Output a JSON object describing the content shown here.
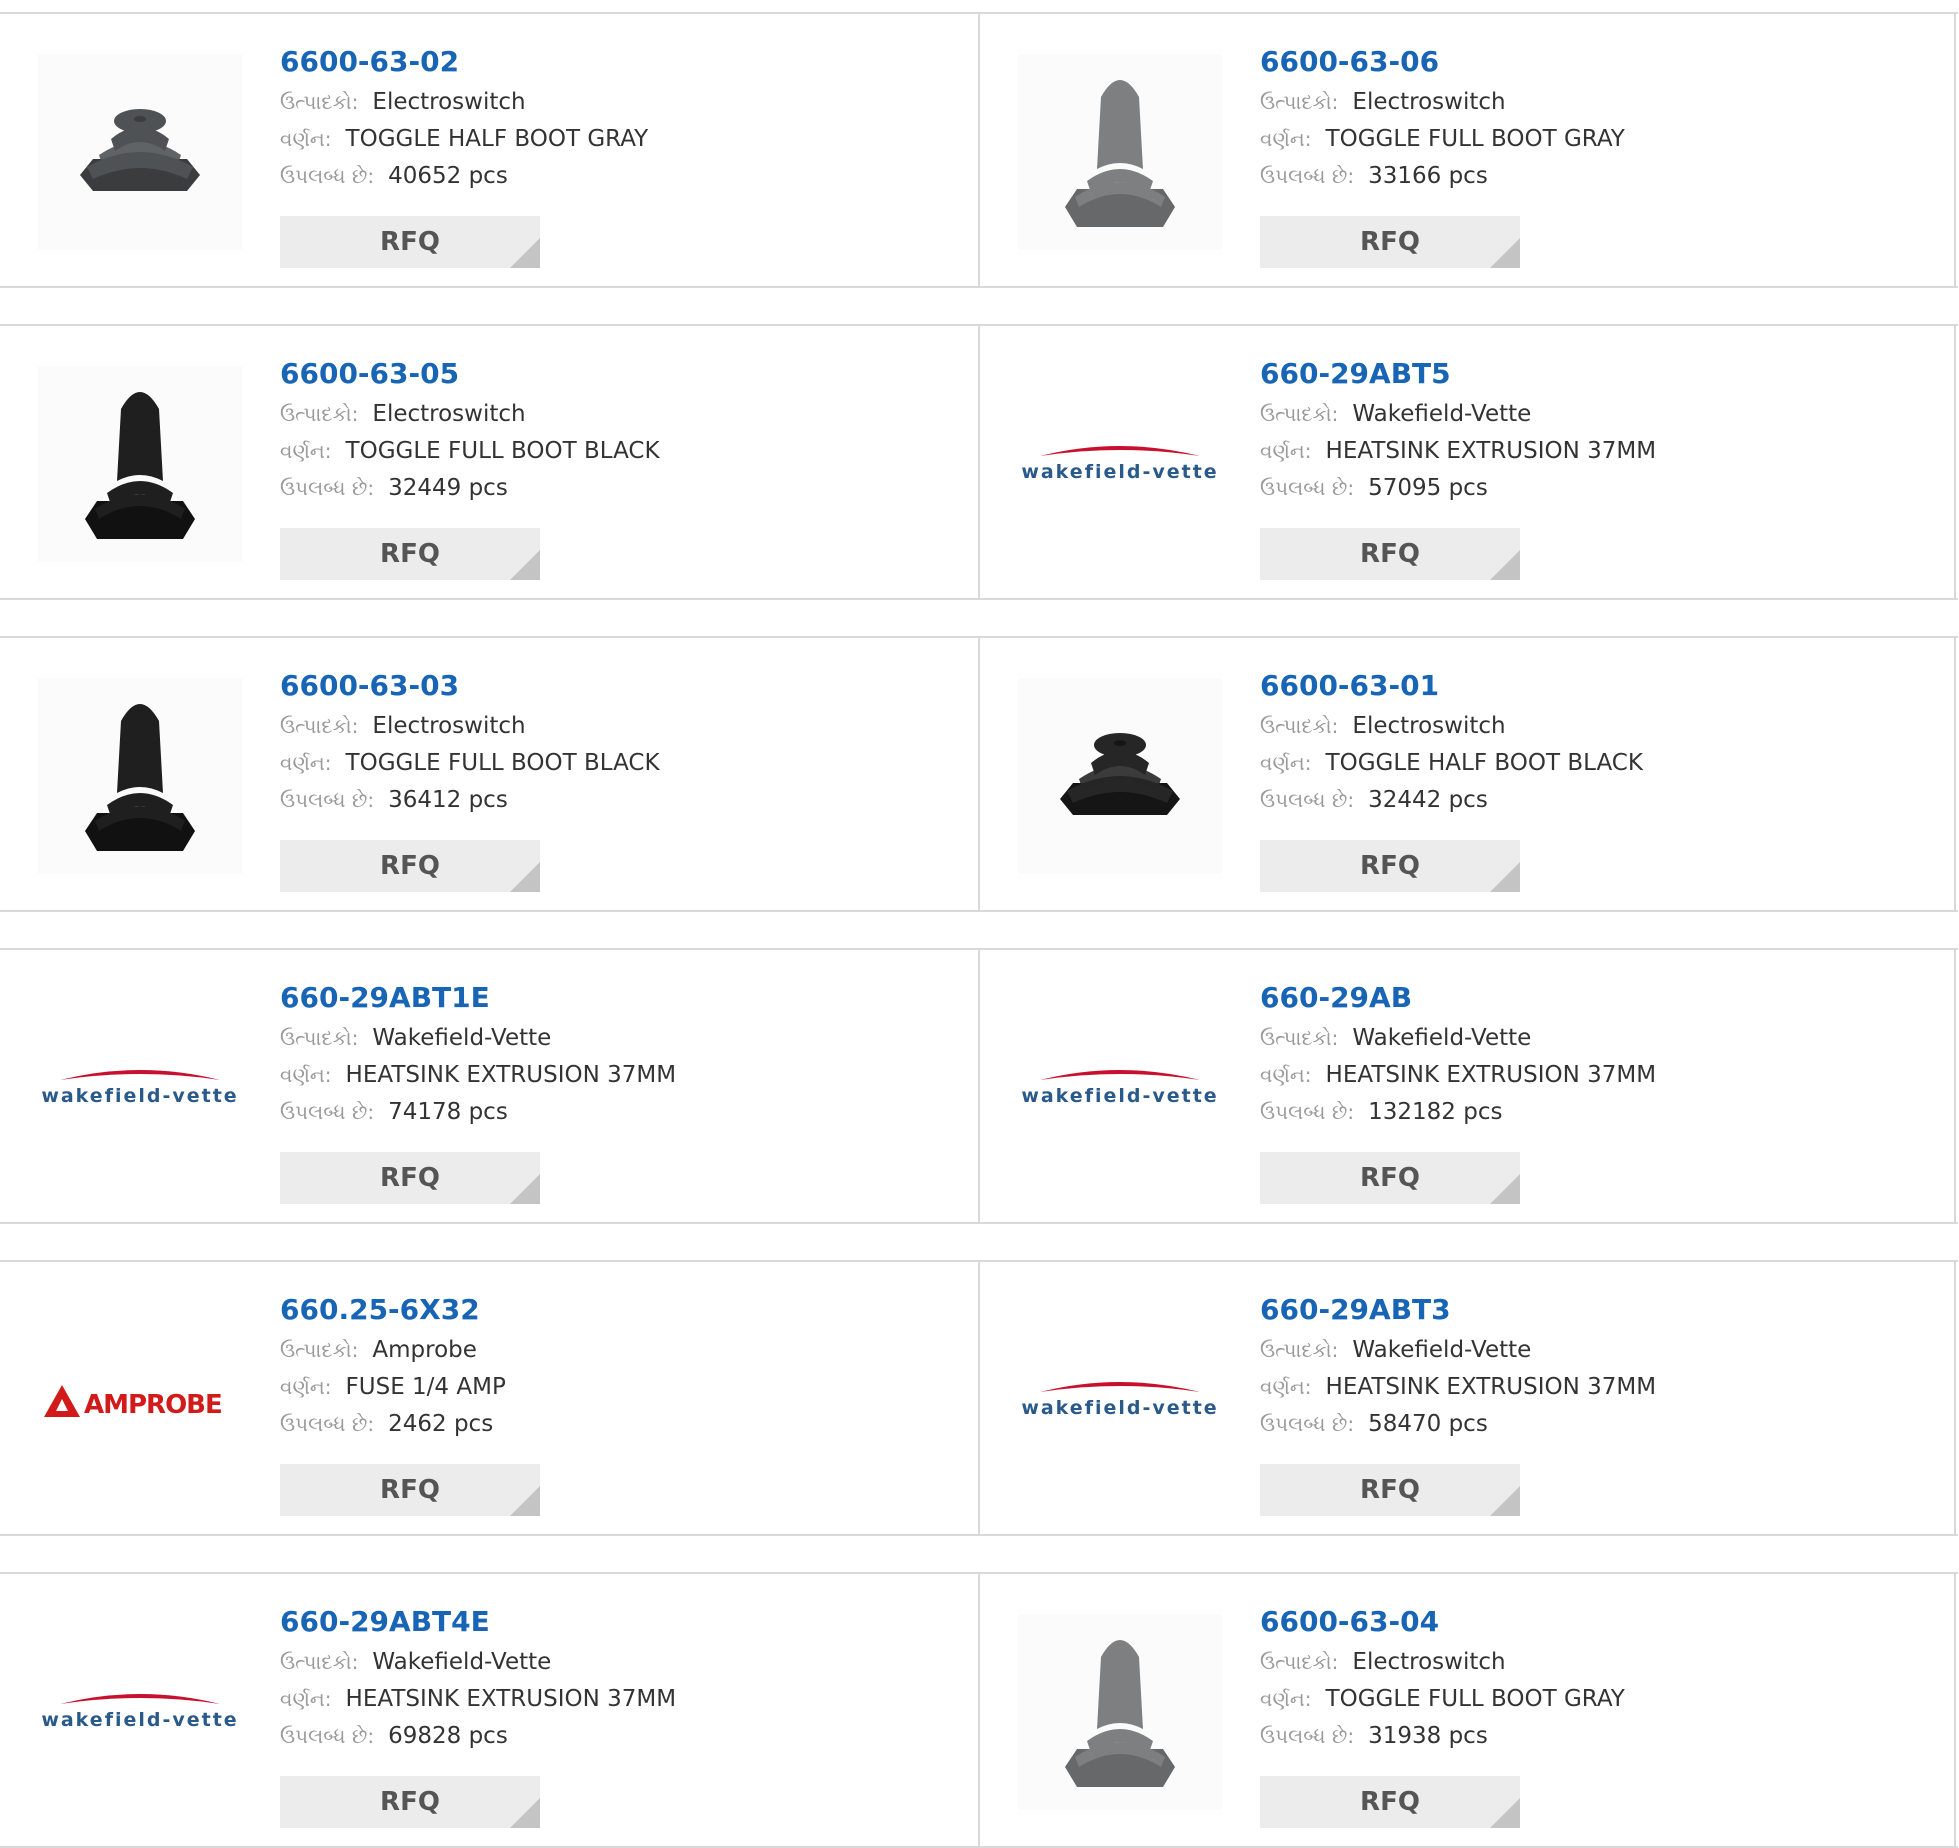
{
  "labels": {
    "manufacturer": "ઉત્પાદકો:",
    "description": "વર્ણન:",
    "available": "ઉપલબ્ધ છે:",
    "rfq": "RFQ"
  },
  "colors": {
    "part_link": "#1765b4",
    "button_bg": "#ececec",
    "border": "#d9d9d9"
  },
  "products": [
    {
      "part": "6600-63-02",
      "manufacturer": "Electroswitch",
      "description": "TOGGLE HALF BOOT GRAY",
      "available": "40652 pcs",
      "image": "half-boot-gray-icon"
    },
    {
      "part": "6600-63-06",
      "manufacturer": "Electroswitch",
      "description": "TOGGLE FULL BOOT GRAY",
      "available": "33166 pcs",
      "image": "full-boot-gray-icon"
    },
    {
      "part": "6600-63-05",
      "manufacturer": "Electroswitch",
      "description": "TOGGLE FULL BOOT BLACK",
      "available": "32449 pcs",
      "image": "full-boot-black-icon"
    },
    {
      "part": "660-29ABT5",
      "manufacturer": "Wakefield-Vette",
      "description": "HEATSINK EXTRUSION 37MM",
      "available": "57095 pcs",
      "image": "wakefield-vette-logo",
      "logo_text": "wakefield-vette"
    },
    {
      "part": "6600-63-03",
      "manufacturer": "Electroswitch",
      "description": "TOGGLE FULL BOOT BLACK",
      "available": "36412 pcs",
      "image": "full-boot-black-icon"
    },
    {
      "part": "6600-63-01",
      "manufacturer": "Electroswitch",
      "description": "TOGGLE HALF BOOT BLACK",
      "available": "32442 pcs",
      "image": "half-boot-black-icon"
    },
    {
      "part": "660-29ABT1E",
      "manufacturer": "Wakefield-Vette",
      "description": "HEATSINK EXTRUSION 37MM",
      "available": "74178 pcs",
      "image": "wakefield-vette-logo",
      "logo_text": "wakefield-vette"
    },
    {
      "part": "660-29AB",
      "manufacturer": "Wakefield-Vette",
      "description": "HEATSINK EXTRUSION 37MM",
      "available": "132182 pcs",
      "image": "wakefield-vette-logo",
      "logo_text": "wakefield-vette"
    },
    {
      "part": "660.25-6X32",
      "manufacturer": "Amprobe",
      "description": "FUSE 1/4 AMP",
      "available": "2462 pcs",
      "image": "amprobe-logo",
      "logo_text": "AMPROBE"
    },
    {
      "part": "660-29ABT3",
      "manufacturer": "Wakefield-Vette",
      "description": "HEATSINK EXTRUSION 37MM",
      "available": "58470 pcs",
      "image": "wakefield-vette-logo",
      "logo_text": "wakefield-vette"
    },
    {
      "part": "660-29ABT4E",
      "manufacturer": "Wakefield-Vette",
      "description": "HEATSINK EXTRUSION 37MM",
      "available": "69828 pcs",
      "image": "wakefield-vette-logo",
      "logo_text": "wakefield-vette"
    },
    {
      "part": "6600-63-04",
      "manufacturer": "Electroswitch",
      "description": "TOGGLE FULL BOOT GRAY",
      "available": "31938 pcs",
      "image": "full-boot-gray-icon"
    }
  ]
}
